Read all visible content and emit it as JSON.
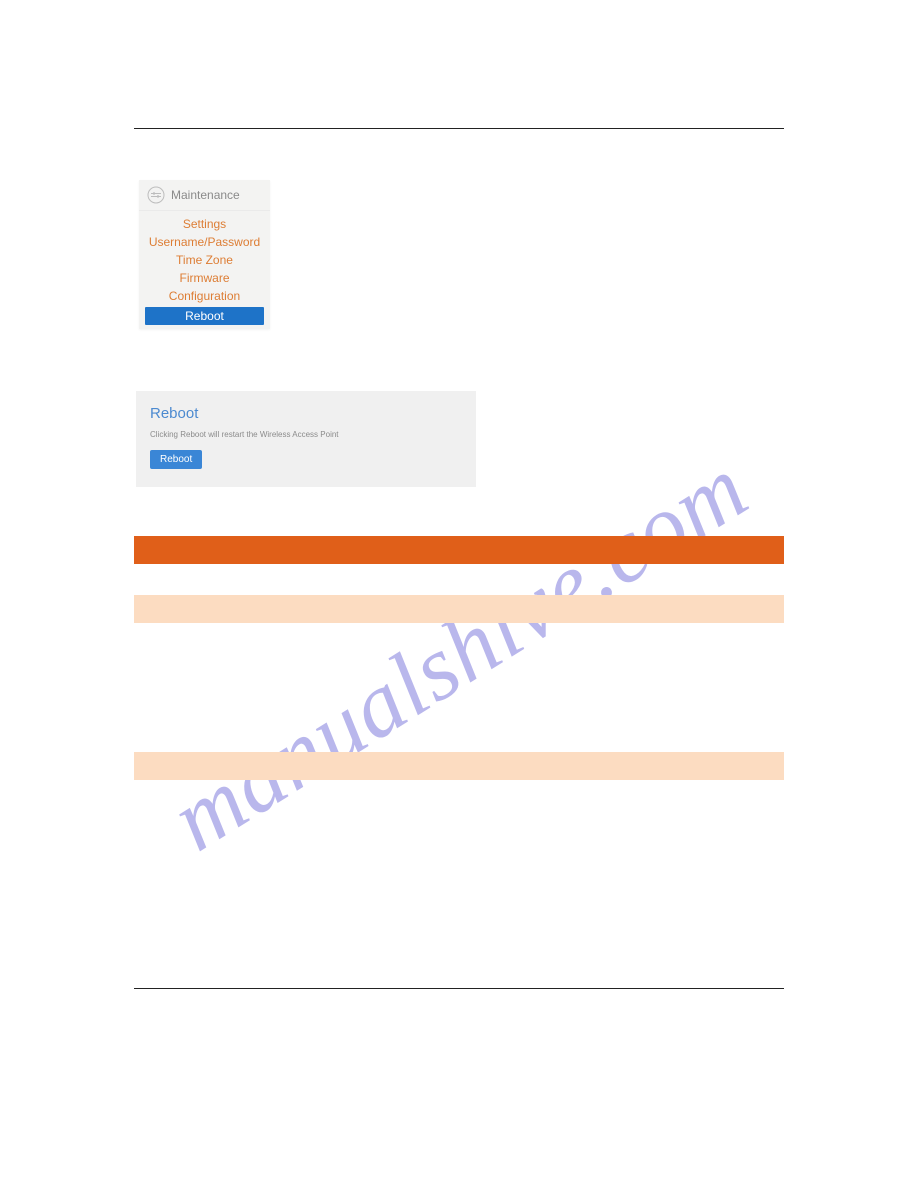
{
  "watermark": "manualshive.com",
  "maintenance": {
    "title": "Maintenance",
    "items": [
      {
        "label": "Settings",
        "selected": false
      },
      {
        "label": "Username/Password",
        "selected": false
      },
      {
        "label": "Time Zone",
        "selected": false
      },
      {
        "label": "Firmware",
        "selected": false
      },
      {
        "label": "Configuration",
        "selected": false
      },
      {
        "label": "Reboot",
        "selected": true
      }
    ]
  },
  "reboot_panel": {
    "title": "Reboot",
    "description": "Clicking Reboot will restart the Wireless Access Point",
    "button_label": "Reboot"
  },
  "bars": {
    "dark_color": "#e05f19",
    "light_color": "#fcdcc1"
  }
}
